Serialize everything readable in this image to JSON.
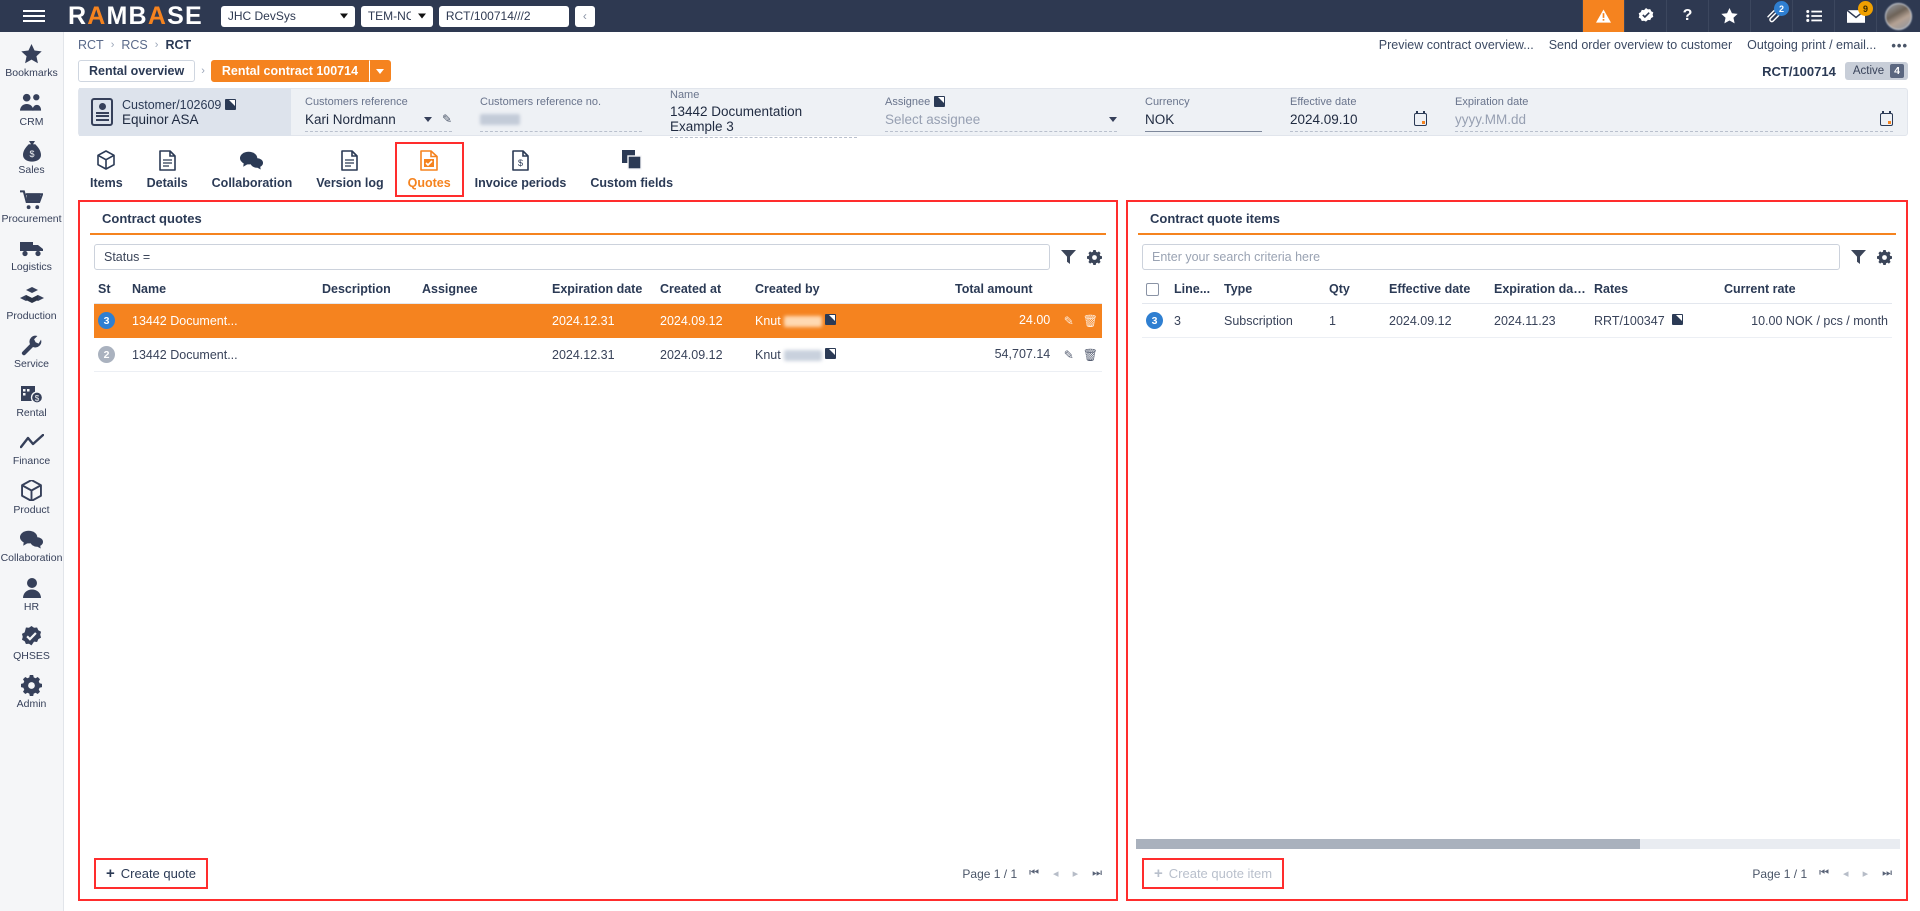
{
  "topbar": {
    "menu_icon": "hamburger-icon",
    "brand": "RAMBASE",
    "company_select": {
      "value": "JHC DevSys",
      "options": [
        "JHC DevSys"
      ]
    },
    "locale_select": {
      "value": "TEM-NO",
      "options": [
        "TEM-NO"
      ]
    },
    "doc_input": {
      "value": "RCT/100714///2",
      "placeholder": ""
    },
    "back_button": "‹",
    "icons": [
      {
        "name": "warning-icon",
        "glyph": "⚠",
        "badge": null,
        "highlight": true
      },
      {
        "name": "qhses-check-icon",
        "glyph": "✔",
        "badge": null,
        "highlight": false
      },
      {
        "name": "help-icon",
        "glyph": "?",
        "badge": null,
        "highlight": false
      },
      {
        "name": "favorites-star-icon",
        "glyph": "★",
        "badge": null,
        "highlight": false
      },
      {
        "name": "attachment-icon",
        "glyph": "ὌE",
        "badge": "2",
        "badge_color": "blue",
        "highlight": false
      },
      {
        "name": "task-list-icon",
        "glyph": "☰",
        "badge": null,
        "highlight": false
      },
      {
        "name": "messages-icon",
        "glyph": "✉",
        "badge": "9",
        "badge_color": "orange",
        "highlight": false
      }
    ],
    "avatar": "user-avatar"
  },
  "sidebar": {
    "items": [
      {
        "label": "Bookmarks",
        "icon": "star-icon"
      },
      {
        "label": "CRM",
        "icon": "people-icon"
      },
      {
        "label": "Sales",
        "icon": "money-bag-icon"
      },
      {
        "label": "Procurement",
        "icon": "shopping-cart-icon"
      },
      {
        "label": "Logistics",
        "icon": "truck-icon"
      },
      {
        "label": "Production",
        "icon": "boxes-icon"
      },
      {
        "label": "Service",
        "icon": "wrench-icon"
      },
      {
        "label": "Rental",
        "icon": "rental-calendar-money-icon"
      },
      {
        "label": "Finance",
        "icon": "line-chart-icon"
      },
      {
        "label": "Product",
        "icon": "cube-icon"
      },
      {
        "label": "Collaboration",
        "icon": "chat-bubbles-icon"
      },
      {
        "label": "HR",
        "icon": "person-icon"
      },
      {
        "label": "QHSES",
        "icon": "check-seal-icon"
      },
      {
        "label": "Admin",
        "icon": "gear-icon"
      }
    ]
  },
  "breadcrumb": {
    "items": [
      "RCT",
      "RCS",
      "RCT"
    ],
    "separator": "›"
  },
  "header_actions": {
    "links": [
      "Preview contract overview...",
      "Send order overview to customer",
      "Outgoing print / email..."
    ],
    "more": "•••"
  },
  "chips": {
    "overview": "Rental overview",
    "separator": "›",
    "current": "Rental contract 100714"
  },
  "doc_status": {
    "id": "RCT/100714",
    "status_label": "Active",
    "status_number": "4"
  },
  "infocard": {
    "customer": {
      "ref": "Customer/102609",
      "name": "Equinor ASA",
      "icon": "contact-card-icon"
    },
    "fields": [
      {
        "label": "Customers reference",
        "value": "Kari Nordmann",
        "placeholder": "",
        "type": "dropdown-edit"
      },
      {
        "label": "Customers reference no.",
        "value": "",
        "placeholder": "",
        "type": "blurred"
      },
      {
        "label": "Name",
        "value": "13442 Documentation Example 3",
        "placeholder": "",
        "type": "text"
      },
      {
        "label": "Assignee",
        "value": "",
        "placeholder": "Select assignee",
        "type": "dropdown",
        "has_link": true
      },
      {
        "label": "Currency",
        "value": "NOK",
        "placeholder": "",
        "type": "text-solid"
      },
      {
        "label": "Effective date",
        "value": "2024.09.10",
        "placeholder": "",
        "type": "date"
      },
      {
        "label": "Expiration date",
        "value": "",
        "placeholder": "yyyy.MM.dd",
        "type": "date"
      }
    ]
  },
  "tabs": [
    {
      "label": "Items",
      "icon": "cube-icon",
      "active": false,
      "highlighted": false
    },
    {
      "label": "Details",
      "icon": "document-icon",
      "active": false,
      "highlighted": false
    },
    {
      "label": "Collaboration",
      "icon": "chat-bubbles-icon",
      "active": false,
      "highlighted": false
    },
    {
      "label": "Version log",
      "icon": "document-icon",
      "active": false,
      "highlighted": false
    },
    {
      "label": "Quotes",
      "icon": "document-check-icon",
      "active": true,
      "highlighted": true
    },
    {
      "label": "Invoice periods",
      "icon": "document-dollar-icon",
      "active": false,
      "highlighted": false
    },
    {
      "label": "Custom fields",
      "icon": "copy-icon",
      "active": false,
      "highlighted": false
    }
  ],
  "left_panel": {
    "title": "Contract quotes",
    "search": {
      "value": "Status =",
      "placeholder": ""
    },
    "columns": [
      "St",
      "Name",
      "Description",
      "Assignee",
      "Expiration date",
      "Created at",
      "Created by",
      "Total amount"
    ],
    "rows": [
      {
        "status": "3",
        "status_color": "blue",
        "name": "13442 Document...",
        "description": "",
        "assignee": "",
        "expiration_date": "2024.12.31",
        "created_at": "2024.09.12",
        "created_by": "Knut",
        "total_amount": "24.00",
        "selected": true
      },
      {
        "status": "2",
        "status_color": "gray",
        "name": "13442 Document...",
        "description": "",
        "assignee": "",
        "expiration_date": "2024.12.31",
        "created_at": "2024.09.12",
        "created_by": "Knut",
        "total_amount": "54,707.14",
        "selected": false
      }
    ],
    "create_button": "Create quote",
    "pager": {
      "label": "Page 1 / 1"
    }
  },
  "right_panel": {
    "title": "Contract quote items",
    "search": {
      "value": "",
      "placeholder": "Enter your search criteria here"
    },
    "columns": [
      "",
      "Line...",
      "Type",
      "Qty",
      "Effective date",
      "Expiration dat...",
      "Rates",
      "Current rate"
    ],
    "rows": [
      {
        "status": "3",
        "status_color": "blue",
        "line": "3",
        "type": "Subscription",
        "qty": "1",
        "effective_date": "2024.09.12",
        "expiration_date": "2024.11.23",
        "rates": "RRT/100347",
        "current_rate": "10.00 NOK / pcs / month"
      }
    ],
    "create_button": "Create quote item",
    "create_button_disabled": true,
    "pager": {
      "label": "Page 1 / 1"
    }
  },
  "colors": {
    "brand_dark": "#2e3951",
    "accent_orange": "#f5831f",
    "highlight_red": "#ff2d2d",
    "status_blue": "#2f7fd1",
    "status_gray": "#aab2bf"
  }
}
